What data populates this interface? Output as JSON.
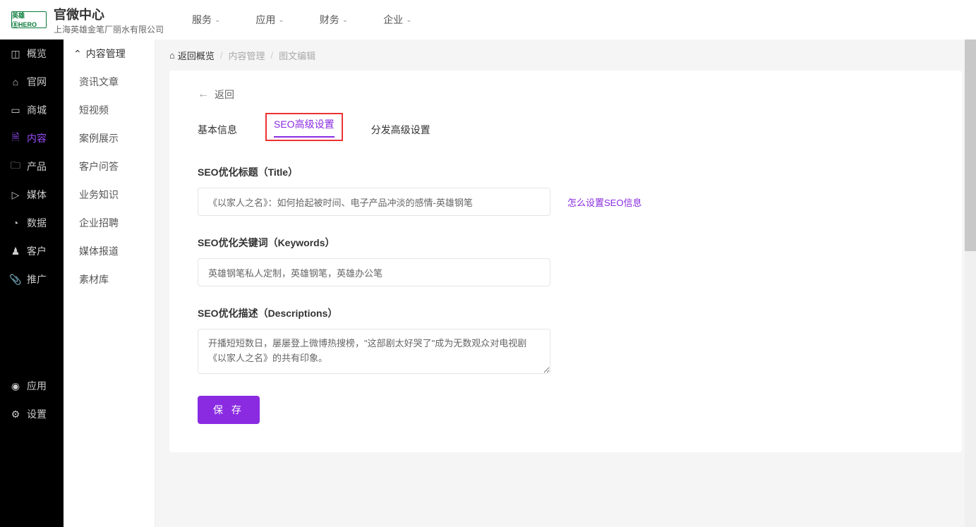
{
  "header": {
    "logo_name": "英雄⑧HERO",
    "title": "官微中心",
    "subtitle": "上海英雄金笔厂丽水有限公司",
    "nav": [
      "服务",
      "应用",
      "财务",
      "企业"
    ]
  },
  "sidebar_left": {
    "top": [
      {
        "icon": "◫",
        "label": "概览"
      },
      {
        "icon": "⌂",
        "label": "官网"
      },
      {
        "icon": "▭",
        "label": "商城"
      },
      {
        "icon": "🗎",
        "label": "内容",
        "active": true
      },
      {
        "icon": "🗀",
        "label": "产品"
      },
      {
        "icon": "▷",
        "label": "媒体"
      },
      {
        "icon": "◔",
        "label": "数据"
      },
      {
        "icon": "♟",
        "label": "客户"
      },
      {
        "icon": "📎",
        "label": "推广"
      }
    ],
    "bottom": [
      {
        "icon": "◉",
        "label": "应用"
      },
      {
        "icon": "⚙",
        "label": "设置"
      }
    ]
  },
  "sidebar_sub": {
    "head": "内容管理",
    "head_chevron": "⌃",
    "items": [
      "资讯文章",
      "短视频",
      "案例展示",
      "客户问答",
      "业务知识",
      "企业招聘",
      "媒体报道",
      "素材库"
    ]
  },
  "breadcrumb": {
    "home_icon": "⌂",
    "home": "返回概览",
    "items": [
      "内容管理",
      "图文编辑"
    ],
    "sep": "/"
  },
  "form": {
    "back_label": "返回",
    "tabs": [
      {
        "label": "基本信息"
      },
      {
        "label": "SEO高级设置",
        "active": true,
        "highlighted": true
      },
      {
        "label": "分发高级设置"
      }
    ],
    "title_field": {
      "label": "SEO优化标题（Title）",
      "value": "《以家人之名》：如何拾起被时间、电子产品冲淡的感情-英雄钢笔",
      "help": "怎么设置SEO信息"
    },
    "keywords_field": {
      "label": "SEO优化关键词（Keywords）",
      "value": "英雄钢笔私人定制，英雄钢笔，英雄办公笔"
    },
    "desc_field": {
      "label": "SEO优化描述（Descriptions）",
      "value": "开播短短数日，屡屡登上微博热搜榜，\"这部剧太好哭了\"成为无数观众对电视剧《以家人之名》的共有印象。"
    },
    "save_label": "保 存"
  }
}
